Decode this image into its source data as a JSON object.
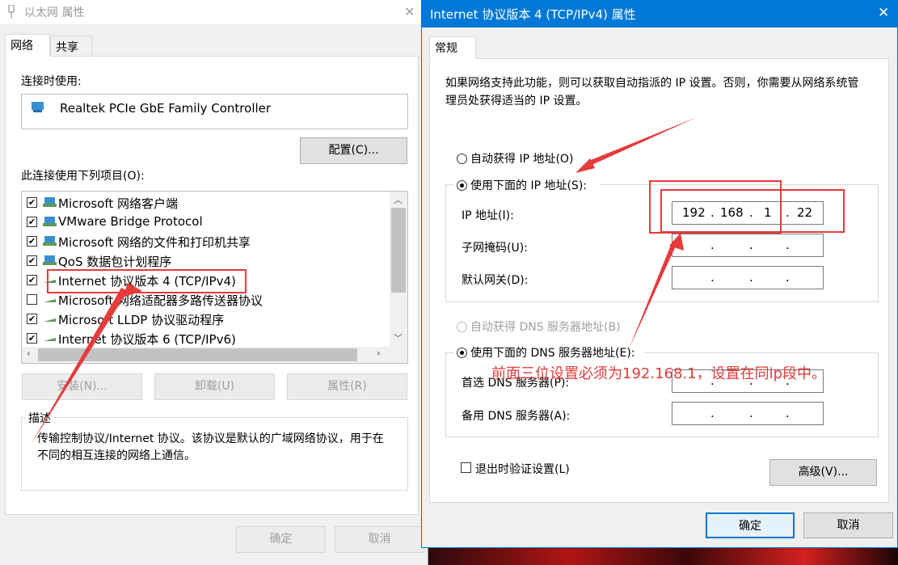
{
  "left_window": {
    "title": "以太网 属性",
    "close": "✕",
    "tabs": [
      {
        "label": "网络"
      },
      {
        "label": "共享"
      }
    ],
    "connect_using_label": "连接时使用:",
    "adapter_name": "Realtek PCIe GbE Family Controller",
    "configure_button": "配置(C)...",
    "items_label": "此连接使用下列项目(O):",
    "items": [
      {
        "label": "Microsoft 网络客户端",
        "checked": true
      },
      {
        "label": "VMware Bridge Protocol",
        "checked": true
      },
      {
        "label": "Microsoft 网络的文件和打印机共享",
        "checked": true
      },
      {
        "label": "QoS 数据包计划程序",
        "checked": true
      },
      {
        "label": "Internet 协议版本 4 (TCP/IPv4)",
        "checked": true
      },
      {
        "label": "Microsoft 网络适配器多路传送器协议",
        "checked": false
      },
      {
        "label": "Microsoft LLDP 协议驱动程序",
        "checked": true
      },
      {
        "label": "Internet 协议版本 6 (TCP/IPv6)",
        "checked": true
      }
    ],
    "install_button": "安装(N)...",
    "uninstall_button": "卸载(U)",
    "properties_button": "属性(R)",
    "description_label": "描述",
    "description_text": "传输控制协议/Internet 协议。该协议是默认的广域网络协议，用于在不同的相互连接的网络上通信。",
    "ok_button": "确定",
    "cancel_button": "取消"
  },
  "right_window": {
    "title": "Internet 协议版本 4 (TCP/IPv4) 属性",
    "close": "✕",
    "tab_general": "常规",
    "intro": "如果网络支持此功能，则可以获取自动指派的 IP 设置。否则，你需要从网络系统管理员处获得适当的 IP 设置。",
    "auto_ip_label": "自动获得 IP 地址(O)",
    "manual_ip_label": "使用下面的 IP 地址(S):",
    "ip_label": "IP 地址(I):",
    "ip_octets": [
      "192",
      "168",
      "1",
      "22"
    ],
    "subnet_label": "子网掩码(U):",
    "gateway_label": "默认网关(D):",
    "auto_dns_label": "自动获得 DNS 服务器地址(B)",
    "manual_dns_label": "使用下面的 DNS 服务器地址(E):",
    "preferred_dns_label": "首选 DNS 服务器(P):",
    "alternate_dns_label": "备用 DNS 服务器(A):",
    "validate_label": "退出时验证设置(L)",
    "advanced_button": "高级(V)...",
    "ok_button": "确定",
    "cancel_button": "取消"
  },
  "annotation": {
    "text": "前面三位设置必须为192.168.1，设置在同ip段中。",
    "color": "#e43b3b"
  },
  "colors": {
    "accent": "#0078d7",
    "annotation": "#e43b3b"
  }
}
